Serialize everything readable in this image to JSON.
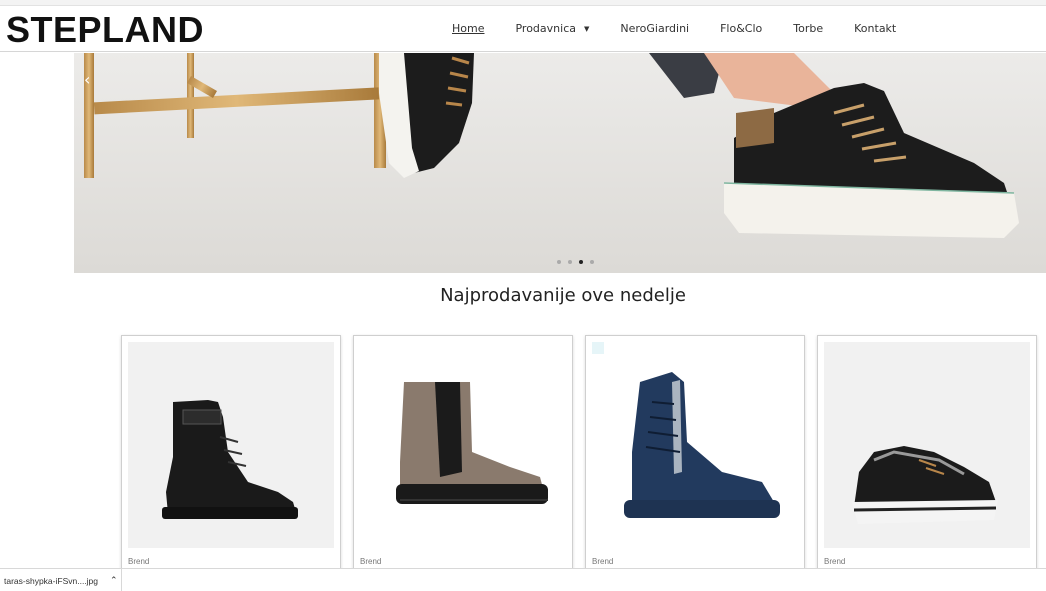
{
  "header": {
    "logo": "STEPLAND",
    "nav": [
      {
        "label": "Home",
        "active": true
      },
      {
        "label": "Prodavnica",
        "has_dropdown": true
      },
      {
        "label": "NeroGiardini"
      },
      {
        "label": "Flo&Clo"
      },
      {
        "label": "Torbe"
      },
      {
        "label": "Kontakt"
      }
    ]
  },
  "hero": {
    "slide_count": 4,
    "active_slide": 3,
    "prev_icon": "chevron-left-icon"
  },
  "section": {
    "title": "Najprodavanije ove nedelje"
  },
  "products": [
    {
      "brand": "Brend",
      "image": "black-combat-boot"
    },
    {
      "brand": "Brend",
      "image": "taupe-chelsea-boot"
    },
    {
      "brand": "Brend",
      "image": "navy-lace-up-boot"
    },
    {
      "brand": "Brend",
      "image": "black-sneaker"
    }
  ],
  "download_bar": {
    "file_name": "taras-shypka-iFSvn....jpg",
    "chevron_icon": "chevron-up-icon"
  },
  "colors": {
    "accent": "#111111",
    "hero_bg": "#e9e8e6",
    "card_bg": "#f1f1f1"
  }
}
